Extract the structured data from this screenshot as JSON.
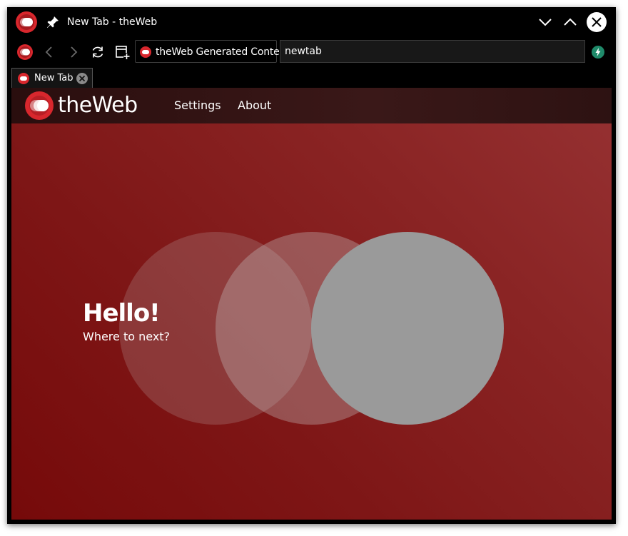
{
  "window": {
    "title": "New Tab - theWeb"
  },
  "icons": {
    "app": "theweb-logo-icon",
    "pin": "pin-icon",
    "minimize": "chevron-down-icon",
    "maximize": "chevron-up-icon",
    "close": "close-icon",
    "back": "chevron-left-icon",
    "forward": "chevron-right-icon",
    "reload": "reload-icon",
    "new_window": "new-window-icon",
    "extension": "lightning-icon",
    "tab_close": "close-circle-icon"
  },
  "toolbar": {
    "security_label": "theWeb Generated Content",
    "address_value": "newtab"
  },
  "tabs": [
    {
      "label": "New Tab",
      "active": true
    }
  ],
  "page": {
    "brand": "theWeb",
    "nav": [
      {
        "label": "Settings"
      },
      {
        "label": "About"
      }
    ],
    "greeting": "Hello!",
    "subtext": "Where to next?"
  },
  "colors": {
    "brand_red": "#d8272d",
    "content_gradient_start": "#963132",
    "content_gradient_end": "#760a0a",
    "extension_green": "#1f8a6a",
    "chrome_background": "#000000"
  }
}
